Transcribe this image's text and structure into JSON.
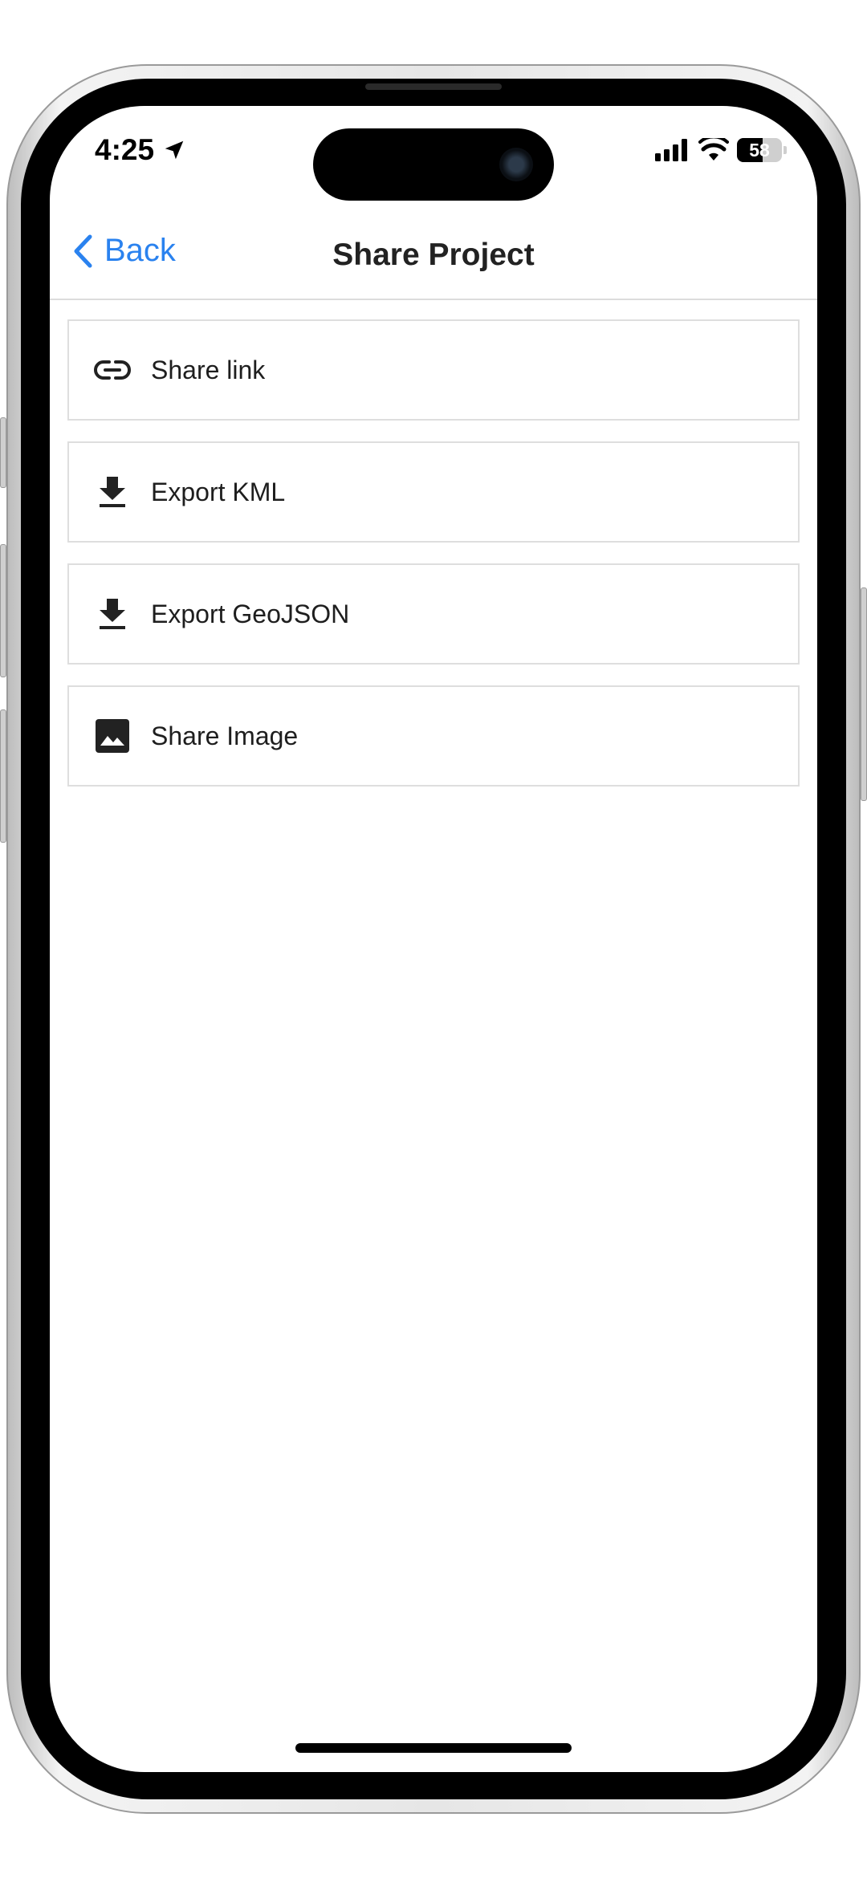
{
  "status_bar": {
    "time": "4:25",
    "battery": "58"
  },
  "nav": {
    "back_label": "Back",
    "title": "Share Project"
  },
  "actions": [
    {
      "label": "Share link",
      "icon": "link-icon"
    },
    {
      "label": "Export KML",
      "icon": "download-icon"
    },
    {
      "label": "Export GeoJSON",
      "icon": "download-icon"
    },
    {
      "label": "Share Image",
      "icon": "image-icon"
    }
  ],
  "colors": {
    "accent": "#2a82ef",
    "text": "#1e1e1e",
    "divider": "#dedede"
  }
}
